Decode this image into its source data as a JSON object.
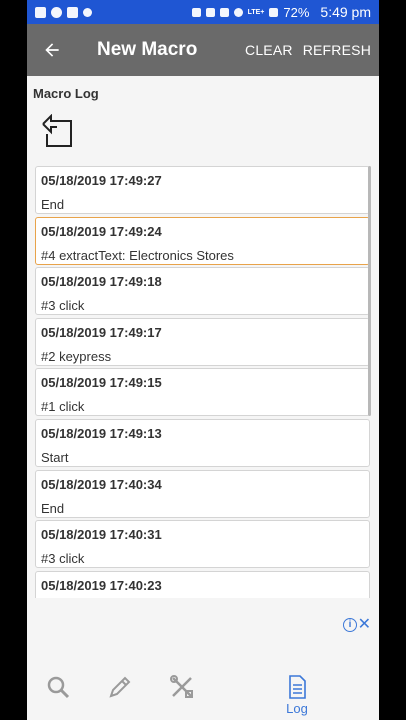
{
  "status_bar": {
    "battery": "72%",
    "time": "5:49 pm",
    "network": "LTE+"
  },
  "app_bar": {
    "title": "New Macro",
    "clear_label": "CLEAR",
    "refresh_label": "REFRESH"
  },
  "section_title": "Macro Log",
  "log_entries": [
    {
      "time": "05/18/2019 17:49:27",
      "message": "End"
    },
    {
      "time": "05/18/2019 17:49:24",
      "message": "#4 extractText: Electronics Stores"
    },
    {
      "time": "05/18/2019 17:49:18",
      "message": "#3 click"
    },
    {
      "time": "05/18/2019 17:49:17",
      "message": "#2 keypress"
    },
    {
      "time": "05/18/2019 17:49:15",
      "message": "#1 click"
    },
    {
      "time": "05/18/2019 17:49:13",
      "message": "Start"
    },
    {
      "time": "05/18/2019 17:40:34",
      "message": "End"
    },
    {
      "time": "05/18/2019 17:40:31",
      "message": "#3 click"
    },
    {
      "time": "05/18/2019 17:40:23",
      "message": ""
    }
  ],
  "selected_index": 1,
  "bottom_nav": {
    "log_label": "Log"
  },
  "colors": {
    "status_bar": "#1f56d3",
    "app_bar": "#6a6a6a",
    "accent": "#3c78d8",
    "selected_border": "#e8a34a"
  },
  "icons": {
    "back": "arrow-left-icon",
    "share": "share-back-icon",
    "search": "search-icon",
    "edit": "pencil-icon",
    "tools": "tools-icon",
    "log": "document-icon"
  }
}
